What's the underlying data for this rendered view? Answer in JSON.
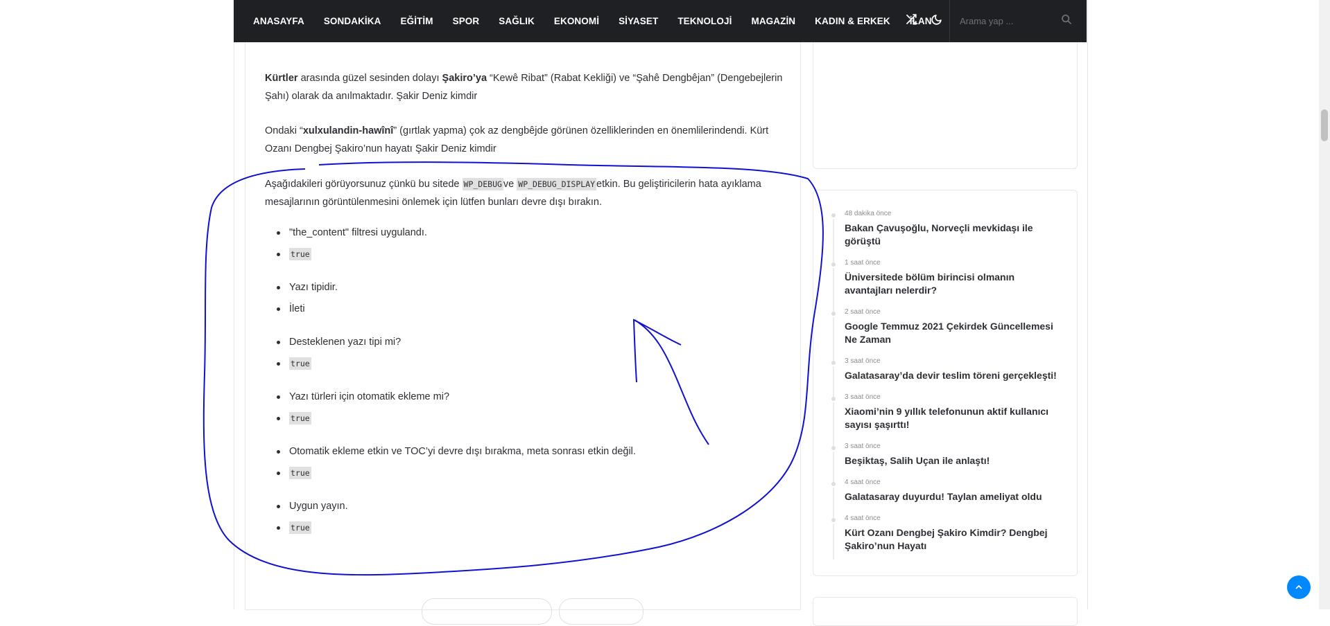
{
  "nav": {
    "items": [
      "ANASAYFA",
      "SONDAKİKA",
      "EĞİTİM",
      "SPOR",
      "SAĞLIK",
      "EKONOMİ",
      "SİYASET",
      "TEKNOLOJİ",
      "MAGAZİN",
      "KADIN & ERKEK",
      "İLAN"
    ],
    "search_placeholder": "Arama yap ..."
  },
  "icons": {
    "shuffle": "shuffle-icon",
    "dark_mode": "moon-icon",
    "search": "search-icon",
    "back_to_top": "chevron-up-icon"
  },
  "colors": {
    "nav_background": "#1f2024",
    "annotation_stroke": "#1010d0",
    "back_to_top": "#0088ff"
  },
  "article": {
    "p1": {
      "b1": "Kürtler",
      "t1": " arasında güzel sesinden dolayı ",
      "b2": "Şakiro’ya",
      "t2": " “Kewê Ribat” (Rabat Kekliği) ve “Şahê Dengbêjan” (Dengebejlerin Şahı) olarak da anılmaktadır. Şakir Deniz kimdir"
    },
    "p2": {
      "t1": "Ondaki “",
      "b1": "xulxulandin-hawînî",
      "t2": "” (gırtlak yapma) çok az dengbêjde görünen özelliklerinden en önemlilerindendi. Kürt Ozanı Dengbej Şakiro’nun hayatı Şakir Deniz kimdir"
    },
    "debug_notice": {
      "t1": "Aşağıdakileri görüyorsunuz çünkü bu sitede ",
      "code1": "WP_DEBUG",
      "t2": "ve ",
      "code2": "WP_DEBUG_DISPLAY",
      "t3": "etkin. Bu geliştiricilerin hata ayıklama mesajlarının görüntülenmesini önlemek için lütfen bunları devre dışı bırakın."
    },
    "debug_items": [
      {
        "label": "\"the_content\" filtresi uygulandı.",
        "value": "true",
        "code": true
      },
      {
        "label": "Yazı tipidir.",
        "value": "İleti",
        "code": false
      },
      {
        "label": "Desteklenen yazı tipi mi?",
        "value": "true",
        "code": true
      },
      {
        "label": "Yazı türleri için otomatik ekleme mi?",
        "value": "true",
        "code": true
      },
      {
        "label": "Otomatik ekleme etkin ve TOC’yi devre dışı bırakma, meta sonrası etkin değil.",
        "value": "true",
        "code": true
      },
      {
        "label": "Uygun yayın.",
        "value": "true",
        "code": true
      }
    ]
  },
  "recent_posts": [
    {
      "time": "48 dakika önce",
      "title": "Bakan Çavuşoğlu, Norveçli mevkidaşı ile görüştü"
    },
    {
      "time": "1 saat önce",
      "title": "Üniversitede bölüm birincisi olmanın avantajları nelerdir?"
    },
    {
      "time": "2 saat önce",
      "title": "Google Temmuz 2021 Çekirdek Güncellemesi Ne Zaman"
    },
    {
      "time": "3 saat önce",
      "title": "Galatasaray’da devir teslim töreni gerçekleşti!"
    },
    {
      "time": "3 saat önce",
      "title": "Xiaomi’nin 9 yıllık telefonunun aktif kullanıcı sayısı şaşırttı!"
    },
    {
      "time": "3 saat önce",
      "title": "Beşiktaş, Salih Uçan ile anlaştı!"
    },
    {
      "time": "4 saat önce",
      "title": "Galatasaray duyurdu! Taylan ameliyat oldu"
    },
    {
      "time": "4 saat önce",
      "title": "Kürt Ozanı Dengbej Şakiro Kimdir? Dengbej Şakiro’nun Hayatı"
    }
  ]
}
